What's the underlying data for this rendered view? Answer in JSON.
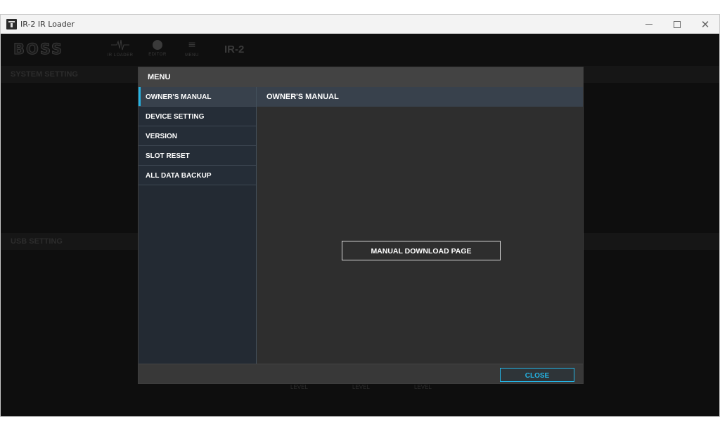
{
  "window": {
    "title": "IR-2 IR Loader",
    "controls": {
      "minimize": "—",
      "close": "✕"
    }
  },
  "toolbar": {
    "logo": "BOSS",
    "items": [
      {
        "label": "IR LOADER",
        "icon": "waveform-icon"
      },
      {
        "label": "EDITOR",
        "icon": "knob-icon"
      },
      {
        "label": "MENU",
        "icon": "hamburger-menu-icon"
      }
    ],
    "model": "IR-2"
  },
  "background": {
    "system_setting": "SYSTEM SETTING",
    "usb_setting": "USB SETTING",
    "level_labels": [
      "LEVEL",
      "LEVEL",
      "LEVEL"
    ]
  },
  "modal": {
    "title": "MENU",
    "menu_items": [
      {
        "label": "OWNER'S MANUAL",
        "active": true
      },
      {
        "label": "DEVICE SETTING",
        "active": false
      },
      {
        "label": "VERSION",
        "active": false
      },
      {
        "label": "SLOT RESET",
        "active": false
      },
      {
        "label": "ALL DATA BACKUP",
        "active": false
      }
    ],
    "content_title": "OWNER'S MANUAL",
    "download_button": "MANUAL DOWNLOAD PAGE",
    "close_button": "CLOSE"
  },
  "colors": {
    "accent": "#24b5e6",
    "modal_header": "#434343",
    "menu_bg": "#232a33",
    "content_bg": "#2e2e2e",
    "app_bg": "#0e0e0e"
  }
}
